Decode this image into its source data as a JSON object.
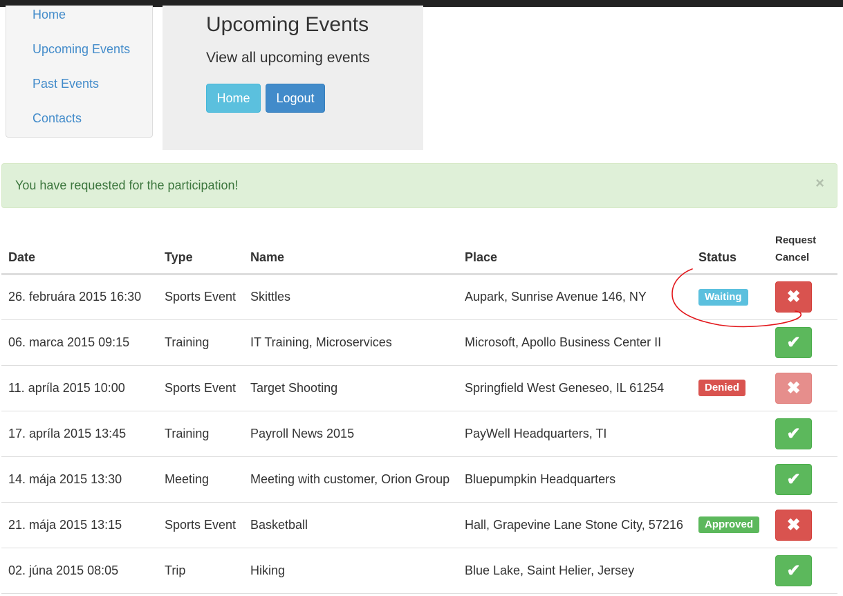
{
  "nav": {
    "items": [
      "Home",
      "Upcoming Events",
      "Past Events",
      "Contacts"
    ]
  },
  "header": {
    "title": "Upcoming Events",
    "subtitle": "View all upcoming events",
    "home_button": "Home",
    "logout_button": "Logout"
  },
  "alert": {
    "message": "You have requested for the participation!",
    "close_symbol": "×"
  },
  "table": {
    "columns": {
      "date": "Date",
      "type": "Type",
      "name": "Name",
      "place": "Place",
      "status": "Status",
      "request_line1": "Request",
      "request_line2": "Cancel"
    },
    "rows": [
      {
        "date": "26. februára 2015 16:30",
        "type": "Sports Event",
        "name": "Skittles",
        "place": "Aupark, Sunrise Avenue 146, NY",
        "status": "Waiting",
        "status_style": "info",
        "action": "cancel",
        "action_icon": "✖",
        "action_enabled": true
      },
      {
        "date": "06. marca 2015 09:15",
        "type": "Training",
        "name": "IT Training, Microservices",
        "place": "Microsoft, Apollo Business Center II",
        "status": "",
        "status_style": "",
        "action": "request",
        "action_icon": "✔",
        "action_enabled": true
      },
      {
        "date": "11. apríla 2015 10:00",
        "type": "Sports Event",
        "name": "Target Shooting",
        "place": "Springfield West Geneseo, IL 61254",
        "status": "Denied",
        "status_style": "danger",
        "action": "cancel",
        "action_icon": "✖",
        "action_enabled": false
      },
      {
        "date": "17. apríla 2015 13:45",
        "type": "Training",
        "name": "Payroll News 2015",
        "place": "PayWell Headquarters, TI",
        "status": "",
        "status_style": "",
        "action": "request",
        "action_icon": "✔",
        "action_enabled": true
      },
      {
        "date": "14. mája 2015 13:30",
        "type": "Meeting",
        "name": "Meeting with customer, Orion Group",
        "place": "Bluepumpkin Headquarters",
        "status": "",
        "status_style": "",
        "action": "request",
        "action_icon": "✔",
        "action_enabled": true
      },
      {
        "date": "21. mája 2015 13:15",
        "type": "Sports Event",
        "name": "Basketball",
        "place": "Hall, Grapevine Lane Stone City, 57216",
        "status": "Approved",
        "status_style": "success",
        "action": "cancel",
        "action_icon": "✖",
        "action_enabled": true
      },
      {
        "date": "02. júna 2015 08:05",
        "type": "Trip",
        "name": "Hiking",
        "place": "Blue Lake, Saint Helier, Jersey",
        "status": "",
        "status_style": "",
        "action": "request",
        "action_icon": "✔",
        "action_enabled": true
      }
    ]
  },
  "colors": {
    "link": "#428bca",
    "info": "#5bc0de",
    "primary": "#428bca",
    "danger": "#d9534f",
    "success": "#5cb85c",
    "alert_bg": "#dff0d8",
    "alert_text": "#3c763d",
    "annotation": "#e2161b"
  }
}
